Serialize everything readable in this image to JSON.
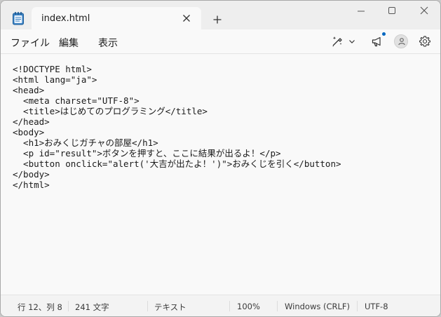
{
  "tab": {
    "title": "index.html"
  },
  "menu": {
    "file": "ファイル",
    "edit": "編集",
    "view": "表示"
  },
  "editor": {
    "lines": [
      "<!DOCTYPE html>",
      "<html lang=\"ja\">",
      "<head>",
      "  <meta charset=\"UTF-8\">",
      "  <title>はじめてのプログラミング</title>",
      "</head>",
      "<body>",
      "  <h1>おみくじガチャの部屋</h1>",
      "  <p id=\"result\">ボタンを押すと、ここに結果が出るよ！</p>",
      "  <button onclick=\"alert('大吉が出たよ！')\">おみくじを引く</button>",
      "</body>",
      "</html>"
    ]
  },
  "status": {
    "position": "行 12、列 8",
    "chars": "241 文字",
    "file_type": "テキスト",
    "zoom": "100%",
    "line_ending": "Windows (CRLF)",
    "encoding": "UTF-8"
  },
  "colors": {
    "accent": "#0067c0",
    "notepad_icon": "#2b6cb0"
  },
  "icons": {
    "app": "notepad-icon",
    "tab_close": "close-icon",
    "new_tab": "plus-icon",
    "minimize": "minimize-icon",
    "maximize": "maximize-icon",
    "close": "close-icon",
    "copilot": "copilot-pen-icon",
    "chevron": "chevron-down-icon",
    "announcements": "megaphone-icon",
    "account": "person-icon",
    "settings": "gear-icon"
  }
}
